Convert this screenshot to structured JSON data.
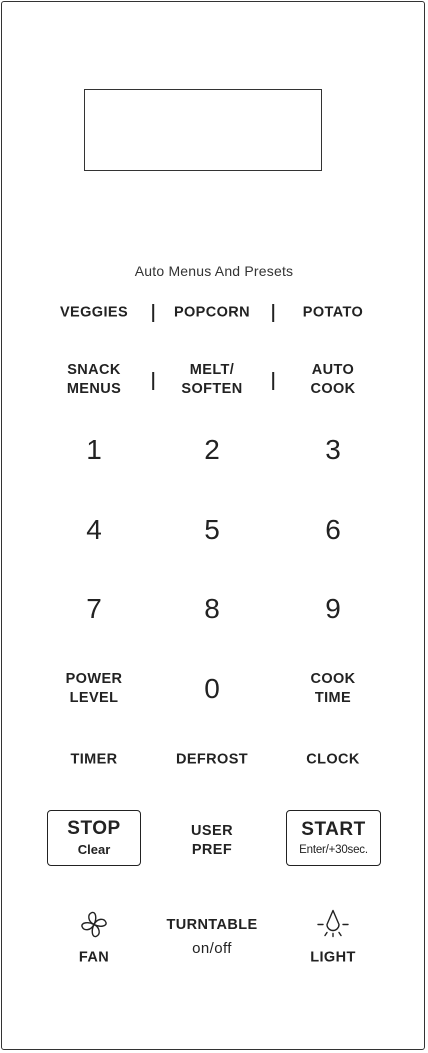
{
  "display": {
    "text": ""
  },
  "heading": "Auto Menus And Presets",
  "auto_row1": {
    "veggies": "VEGGIES",
    "popcorn": "POPCORN",
    "potato": "POTATO"
  },
  "auto_row2": {
    "snack_menus": [
      "SNACK",
      "MENUS"
    ],
    "melt_soften": [
      "MELT/",
      "SOFTEN"
    ],
    "auto_cook": [
      "AUTO",
      "COOK"
    ]
  },
  "keypad": {
    "k1": "1",
    "k2": "2",
    "k3": "3",
    "k4": "4",
    "k5": "5",
    "k6": "6",
    "k7": "7",
    "k8": "8",
    "k9": "9",
    "k0": "0"
  },
  "power_level": [
    "POWER",
    "LEVEL"
  ],
  "cook_time": [
    "COOK",
    "TIME"
  ],
  "timer": "TIMER",
  "defrost": "DEFROST",
  "clock": "CLOCK",
  "stop": {
    "main": "STOP",
    "sub": "Clear"
  },
  "user_pref": [
    "USER",
    "PREF"
  ],
  "start": {
    "main": "START",
    "sub": "Enter/+30sec."
  },
  "fan": {
    "label": "FAN",
    "icon": "fan-icon"
  },
  "turntable": [
    "TURNTABLE",
    "on/off"
  ],
  "light": {
    "label": "LIGHT",
    "icon": "light-bulb-icon"
  }
}
